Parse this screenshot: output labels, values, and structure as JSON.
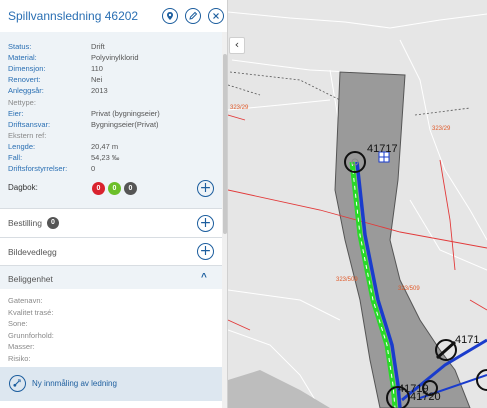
{
  "panel": {
    "title": "Spillvannsledning 46202",
    "header_icons": [
      "location-pin-icon",
      "edit-pencil-icon",
      "close-icon"
    ]
  },
  "properties": [
    {
      "label": "Status:",
      "value": "Drift",
      "muted": false
    },
    {
      "label": "Material:",
      "value": "Polyvinylklorid",
      "muted": false
    },
    {
      "label": "Dimensjon:",
      "value": "110",
      "muted": false
    },
    {
      "label": "Renovert:",
      "value": "Nei",
      "muted": false
    },
    {
      "label": "Anleggsår:",
      "value": "2013",
      "muted": false
    },
    {
      "label": "Nettype:",
      "value": "",
      "muted": true
    },
    {
      "label": "Eier:",
      "value": "Privat (bygningseier)",
      "muted": false
    },
    {
      "label": "Driftsansvar:",
      "value": "Bygningseier(Privat)",
      "muted": false
    },
    {
      "label": "Ekstern ref:",
      "value": "",
      "muted": true
    },
    {
      "label": "Lengde:",
      "value": "20,47 m",
      "muted": false
    },
    {
      "label": "Fall:",
      "value": "54,23 ‰",
      "muted": false
    },
    {
      "label": "Driftsforstyrrelser:",
      "value": "0",
      "muted": false
    }
  ],
  "dagbok": {
    "label": "Dagbok:",
    "badges": [
      {
        "value": "0",
        "color": "#d9232e"
      },
      {
        "value": "0",
        "color": "#6cbf2a"
      },
      {
        "value": "0",
        "color": "#555555"
      }
    ],
    "add_symbol": "+"
  },
  "bestilling": {
    "label": "Bestilling",
    "count": "0",
    "add_symbol": "+"
  },
  "bildevedlegg": {
    "label": "Bildevedlegg",
    "add_symbol": "+"
  },
  "beliggenhet": {
    "label": "Beliggenhet",
    "toggle": "^",
    "rows": [
      "Gatenavn:",
      "Kvalitet trasé:",
      "Sone:",
      "Grunnforhold:",
      "Masser:",
      "Risiko:"
    ]
  },
  "ny_innmaling": {
    "label": "Ny innmåling av ledning"
  },
  "map": {
    "collapse_symbol": "‹",
    "parcel_labels": [
      "323/29",
      "323/29",
      "323/509",
      "323/509"
    ],
    "node_labels": [
      "41717",
      "4171",
      "41719",
      "41720"
    ],
    "colors": {
      "selected_pipe": "#22dd22",
      "pipe": "#1a3ccc",
      "parcel_line": "#e23a3a",
      "parcel_text": "#e05a2a",
      "building": "#9a9a9a",
      "background": "#e6e6e6"
    }
  }
}
